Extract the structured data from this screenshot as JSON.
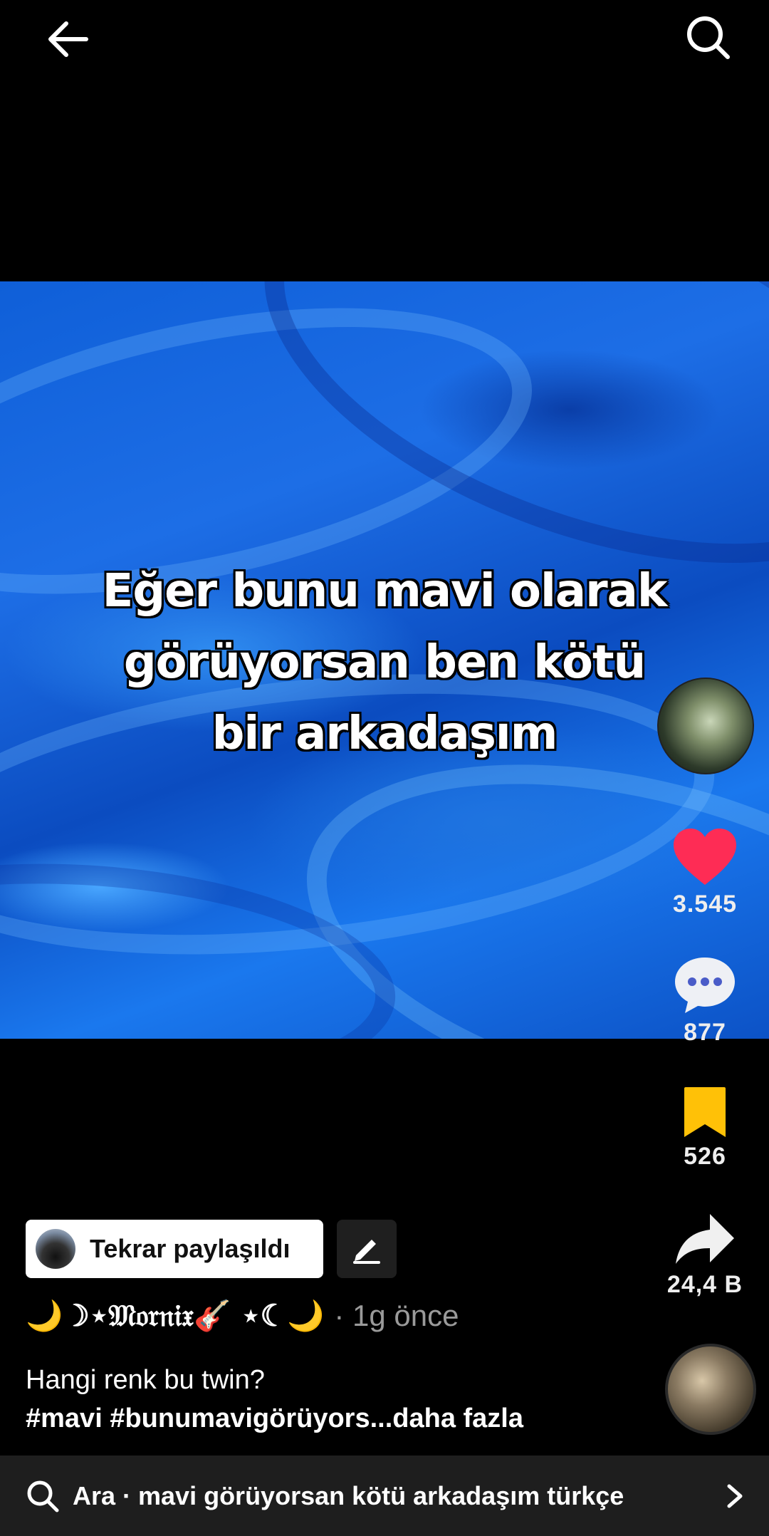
{
  "video": {
    "overlay_text_lines": [
      "Eğer bunu mavi olarak",
      "görüyorsan ben kötü",
      "bir arkadaşım"
    ]
  },
  "actions": {
    "likes": "3.545",
    "comments": "877",
    "saves": "526",
    "shares": "24,4 B"
  },
  "colors": {
    "like": "#fe2c55",
    "save": "#ffc107"
  },
  "repost": {
    "label": "Tekrar paylaşıldı"
  },
  "post": {
    "author": "🌙☽⋆𝔐𝔬𝔯𝔫𝔦𝔵🎸 ⋆☾🌙",
    "time": "· 1g önce",
    "caption": "Hangi renk bu twin?",
    "hashtags": "#mavi #bunumavigörüyors...",
    "more": "daha fazla"
  },
  "bottom_search": {
    "text": "Ara · mavi görüyorsan kötü arkadaşım türkçe"
  }
}
